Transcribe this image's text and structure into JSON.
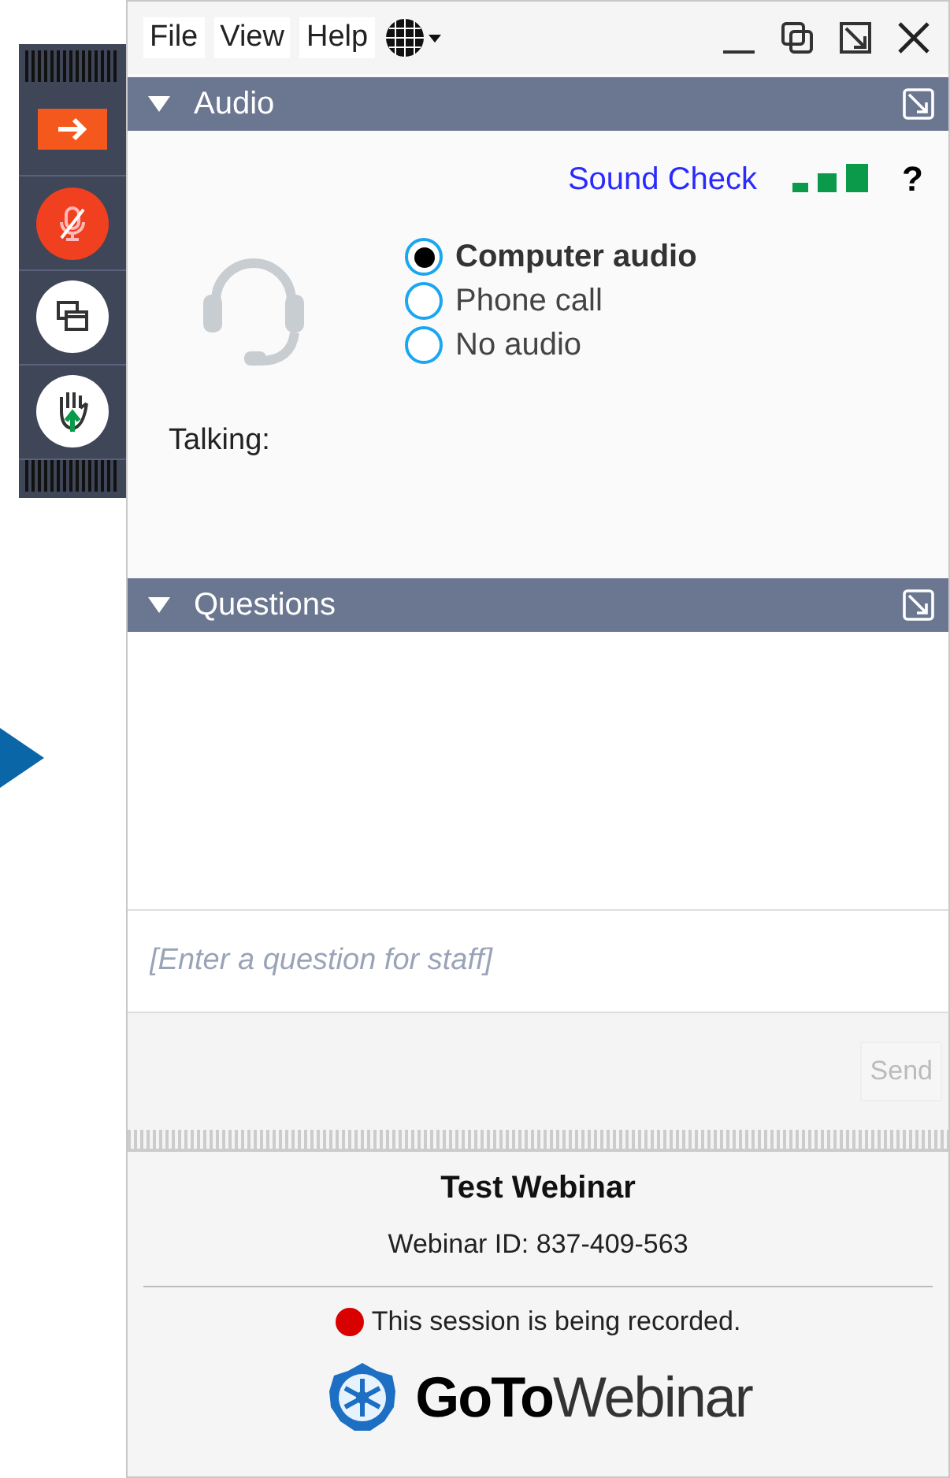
{
  "toolbar": {
    "buttons": [
      {
        "kind": "collapse"
      },
      {
        "kind": "microphone",
        "muted": true
      },
      {
        "kind": "screen"
      },
      {
        "kind": "hand"
      }
    ]
  },
  "menu": [
    "File",
    "View",
    "Help"
  ],
  "panels": [
    {
      "kind": "audio",
      "title": "Audio",
      "expanded": true
    },
    {
      "kind": "questions",
      "title": "Questions",
      "expanded": true
    }
  ],
  "audio": {
    "sound_check": "Sound Check",
    "help": "?",
    "options": [
      {
        "label": "Computer audio",
        "selected": true
      },
      {
        "label": "Phone call",
        "selected": false
      },
      {
        "label": "No audio",
        "selected": false
      }
    ],
    "talking": "Talking:"
  },
  "questions": {
    "placeholder": "[Enter a question for staff]",
    "send": {
      "label": "Send",
      "disabled": true
    }
  },
  "footer": {
    "title": "Test Webinar",
    "webinar_id": "Webinar ID: 837-409-563",
    "recording": {
      "text": "This session is being recorded.",
      "on": true
    },
    "logo": "**GoTo**Webinar"
  }
}
